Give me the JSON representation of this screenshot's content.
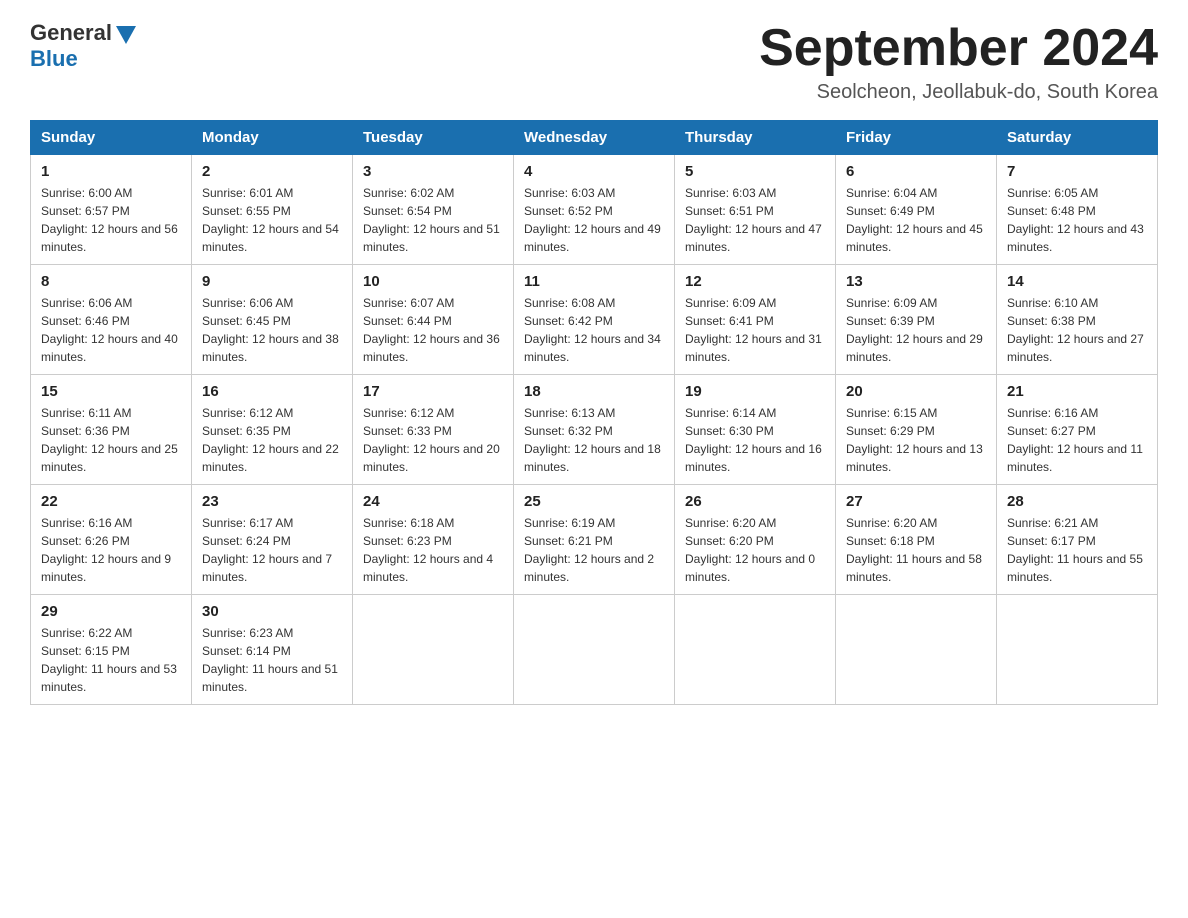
{
  "header": {
    "logo_general": "General",
    "logo_blue": "Blue",
    "title": "September 2024",
    "subtitle": "Seolcheon, Jeollabuk-do, South Korea"
  },
  "weekdays": [
    "Sunday",
    "Monday",
    "Tuesday",
    "Wednesday",
    "Thursday",
    "Friday",
    "Saturday"
  ],
  "weeks": [
    [
      {
        "day": "1",
        "sunrise": "6:00 AM",
        "sunset": "6:57 PM",
        "daylight": "12 hours and 56 minutes."
      },
      {
        "day": "2",
        "sunrise": "6:01 AM",
        "sunset": "6:55 PM",
        "daylight": "12 hours and 54 minutes."
      },
      {
        "day": "3",
        "sunrise": "6:02 AM",
        "sunset": "6:54 PM",
        "daylight": "12 hours and 51 minutes."
      },
      {
        "day": "4",
        "sunrise": "6:03 AM",
        "sunset": "6:52 PM",
        "daylight": "12 hours and 49 minutes."
      },
      {
        "day": "5",
        "sunrise": "6:03 AM",
        "sunset": "6:51 PM",
        "daylight": "12 hours and 47 minutes."
      },
      {
        "day": "6",
        "sunrise": "6:04 AM",
        "sunset": "6:49 PM",
        "daylight": "12 hours and 45 minutes."
      },
      {
        "day": "7",
        "sunrise": "6:05 AM",
        "sunset": "6:48 PM",
        "daylight": "12 hours and 43 minutes."
      }
    ],
    [
      {
        "day": "8",
        "sunrise": "6:06 AM",
        "sunset": "6:46 PM",
        "daylight": "12 hours and 40 minutes."
      },
      {
        "day": "9",
        "sunrise": "6:06 AM",
        "sunset": "6:45 PM",
        "daylight": "12 hours and 38 minutes."
      },
      {
        "day": "10",
        "sunrise": "6:07 AM",
        "sunset": "6:44 PM",
        "daylight": "12 hours and 36 minutes."
      },
      {
        "day": "11",
        "sunrise": "6:08 AM",
        "sunset": "6:42 PM",
        "daylight": "12 hours and 34 minutes."
      },
      {
        "day": "12",
        "sunrise": "6:09 AM",
        "sunset": "6:41 PM",
        "daylight": "12 hours and 31 minutes."
      },
      {
        "day": "13",
        "sunrise": "6:09 AM",
        "sunset": "6:39 PM",
        "daylight": "12 hours and 29 minutes."
      },
      {
        "day": "14",
        "sunrise": "6:10 AM",
        "sunset": "6:38 PM",
        "daylight": "12 hours and 27 minutes."
      }
    ],
    [
      {
        "day": "15",
        "sunrise": "6:11 AM",
        "sunset": "6:36 PM",
        "daylight": "12 hours and 25 minutes."
      },
      {
        "day": "16",
        "sunrise": "6:12 AM",
        "sunset": "6:35 PM",
        "daylight": "12 hours and 22 minutes."
      },
      {
        "day": "17",
        "sunrise": "6:12 AM",
        "sunset": "6:33 PM",
        "daylight": "12 hours and 20 minutes."
      },
      {
        "day": "18",
        "sunrise": "6:13 AM",
        "sunset": "6:32 PM",
        "daylight": "12 hours and 18 minutes."
      },
      {
        "day": "19",
        "sunrise": "6:14 AM",
        "sunset": "6:30 PM",
        "daylight": "12 hours and 16 minutes."
      },
      {
        "day": "20",
        "sunrise": "6:15 AM",
        "sunset": "6:29 PM",
        "daylight": "12 hours and 13 minutes."
      },
      {
        "day": "21",
        "sunrise": "6:16 AM",
        "sunset": "6:27 PM",
        "daylight": "12 hours and 11 minutes."
      }
    ],
    [
      {
        "day": "22",
        "sunrise": "6:16 AM",
        "sunset": "6:26 PM",
        "daylight": "12 hours and 9 minutes."
      },
      {
        "day": "23",
        "sunrise": "6:17 AM",
        "sunset": "6:24 PM",
        "daylight": "12 hours and 7 minutes."
      },
      {
        "day": "24",
        "sunrise": "6:18 AM",
        "sunset": "6:23 PM",
        "daylight": "12 hours and 4 minutes."
      },
      {
        "day": "25",
        "sunrise": "6:19 AM",
        "sunset": "6:21 PM",
        "daylight": "12 hours and 2 minutes."
      },
      {
        "day": "26",
        "sunrise": "6:20 AM",
        "sunset": "6:20 PM",
        "daylight": "12 hours and 0 minutes."
      },
      {
        "day": "27",
        "sunrise": "6:20 AM",
        "sunset": "6:18 PM",
        "daylight": "11 hours and 58 minutes."
      },
      {
        "day": "28",
        "sunrise": "6:21 AM",
        "sunset": "6:17 PM",
        "daylight": "11 hours and 55 minutes."
      }
    ],
    [
      {
        "day": "29",
        "sunrise": "6:22 AM",
        "sunset": "6:15 PM",
        "daylight": "11 hours and 53 minutes."
      },
      {
        "day": "30",
        "sunrise": "6:23 AM",
        "sunset": "6:14 PM",
        "daylight": "11 hours and 51 minutes."
      },
      null,
      null,
      null,
      null,
      null
    ]
  ]
}
